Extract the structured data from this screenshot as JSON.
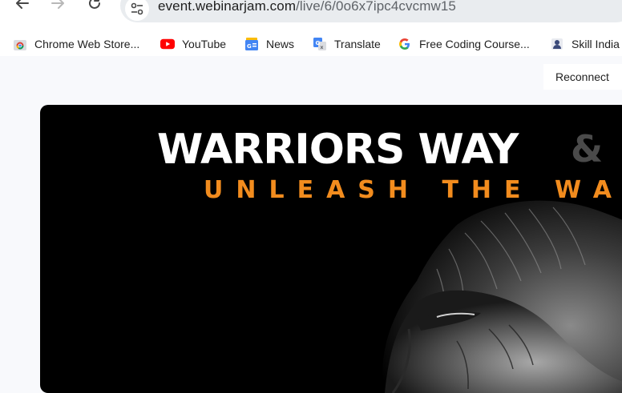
{
  "browser": {
    "url_host": "event.webinarjam.com",
    "url_path": "/live/6/0o6x7ipc4cvcmw15",
    "nav": {
      "back_icon": "back-arrow-icon",
      "forward_icon": "forward-arrow-icon",
      "reload_icon": "reload-icon"
    }
  },
  "bookmarks": [
    {
      "label": "Chrome Web Store...",
      "icon": "chrome-web-store-icon"
    },
    {
      "label": "YouTube",
      "icon": "youtube-icon"
    },
    {
      "label": "News",
      "icon": "google-news-icon"
    },
    {
      "label": "Translate",
      "icon": "google-translate-icon"
    },
    {
      "label": "Free Coding Course...",
      "icon": "google-g-icon"
    },
    {
      "label": "Skill India",
      "icon": "skill-india-icon"
    }
  ],
  "page": {
    "reconnect_label": "Reconnect",
    "banner_title": "WARRIORS WAY",
    "banner_amp": "&",
    "banner_subtitle": "UNLEASH THE WAR"
  },
  "colors": {
    "accent_orange": "#f28c1e",
    "video_bg": "#000000",
    "page_bg": "#f8f9fc",
    "omnibox": "#e9ecef"
  }
}
